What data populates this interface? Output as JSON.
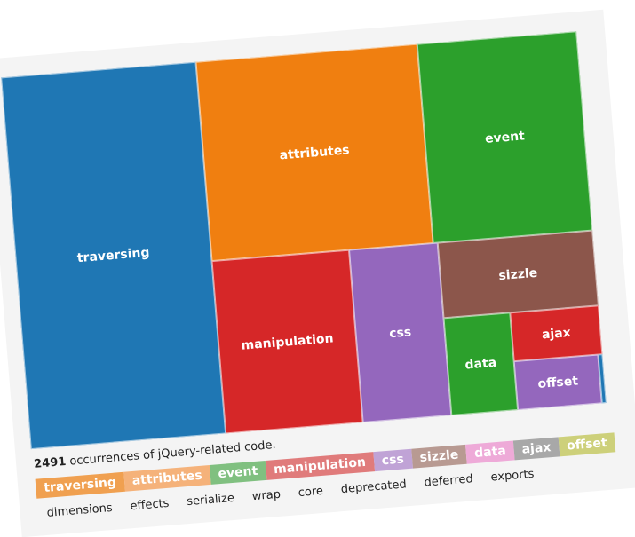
{
  "chart_data": {
    "type": "treemap",
    "total": 2491,
    "caption_suffix": "occurrences of jQuery-related code.",
    "nodes": [
      {
        "name": "traversing",
        "value": 840,
        "color": "#1f77b4"
      },
      {
        "name": "attributes",
        "value": 513,
        "color": "#f07f10"
      },
      {
        "name": "event",
        "value": 359,
        "color": "#2ca02c"
      },
      {
        "name": "manipulation",
        "value": 276,
        "color": "#d62728"
      },
      {
        "name": "css",
        "value": 178,
        "color": "#9467bd"
      },
      {
        "name": "sizzle",
        "value": 124,
        "color": "#8c564b"
      },
      {
        "name": "data",
        "value": 75,
        "color": "#2ca02c"
      },
      {
        "name": "ajax",
        "value": 43,
        "color": "#d62728"
      },
      {
        "name": "offset",
        "value": 40,
        "color": "#9467bd"
      },
      {
        "name": "",
        "value": 3,
        "color": "#1f77b4"
      }
    ],
    "legend_colored": [
      {
        "label": "traversing",
        "color": "#f0a050"
      },
      {
        "label": "attributes",
        "color": "#f5b27a"
      },
      {
        "label": "event",
        "color": "#80c080"
      },
      {
        "label": "manipulation",
        "color": "#e07b7b"
      },
      {
        "label": "css",
        "color": "#c0a3d6"
      },
      {
        "label": "sizzle",
        "color": "#b89a92"
      },
      {
        "label": "data",
        "color": "#eeaad8"
      },
      {
        "label": "ajax",
        "color": "#a8a8a8"
      },
      {
        "label": "offset",
        "color": "#cdd07a"
      }
    ],
    "legend_plain": [
      "dimensions",
      "effects",
      "serialize",
      "wrap",
      "core",
      "deprecated",
      "deferred",
      "exports"
    ]
  }
}
